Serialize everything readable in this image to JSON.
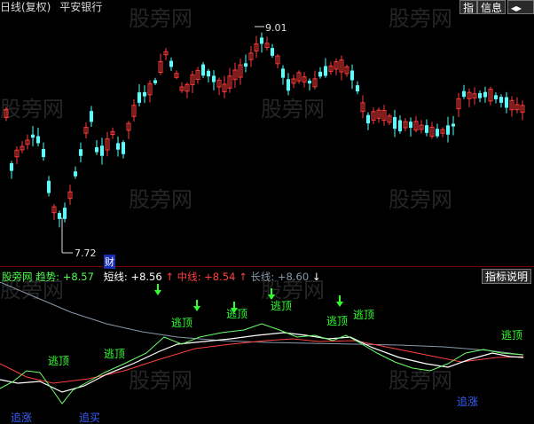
{
  "header": {
    "period": "日线(复权)",
    "stock_name": "平安银行",
    "buttons": [
      "指",
      "信息"
    ],
    "arrows_label": "◂▸"
  },
  "price_labels": {
    "high": "9.01",
    "low": "7.72",
    "cai": "财"
  },
  "indicator": {
    "name": "股旁网 趋势:",
    "trend_value": "+8.57",
    "short_label": "短线:",
    "short_value": "+8.56",
    "mid_label": "中线:",
    "mid_value": "+8.54",
    "long_label": "长线:",
    "long_value": "+8.60",
    "button": "指标说明"
  },
  "signals": {
    "escape_top": "逃顶",
    "chase_up": "追涨",
    "chase_buy": "追买"
  },
  "watermark": "股旁网",
  "colors": {
    "up": "#ff3a3a",
    "down": "#54ffff",
    "white": "#ffffff",
    "trend_green": "#6bff6b",
    "escape_green": "#2fff2f",
    "mid_red": "#ff4040",
    "long_gray": "#8899aa",
    "chase_blue": "#3b5fff"
  }
}
